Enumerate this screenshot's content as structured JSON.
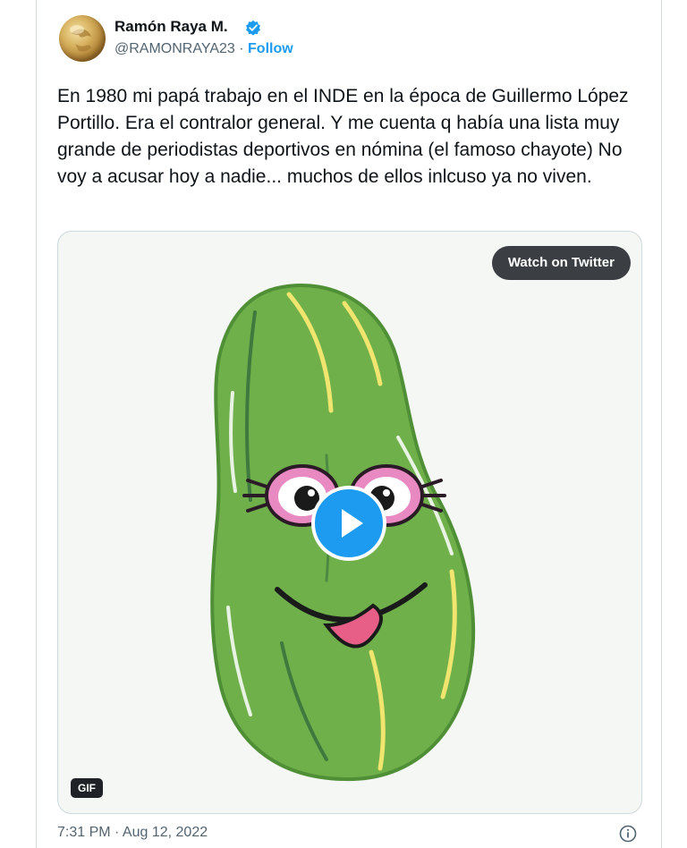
{
  "tweet": {
    "author_name": "Ramón Raya M.",
    "handle": "@RAMONRAYA23",
    "separator": "·",
    "follow_label": "Follow",
    "text": "En 1980 mi papá trabajo en el INDE en la época de Guillermo López Portillo. Era el contralor general. Y me cuenta q había una lista muy grande de periodistas deportivos en nómina (el famoso chayote) No voy a acusar hoy a nadie... muchos de ellos inlcuso ya no viven.",
    "timestamp": "7:31 PM · Aug 12, 2022"
  },
  "media": {
    "watch_label": "Watch on Twitter",
    "gif_badge": "GIF",
    "subject_icon": "chayote-cartoon",
    "play_icon": "play-icon"
  },
  "colors": {
    "accent": "#1d9bf0",
    "text": "#0f1419",
    "muted": "#536471",
    "chayote_green": "#6fb04b",
    "button_dark": "#3b3f44"
  }
}
